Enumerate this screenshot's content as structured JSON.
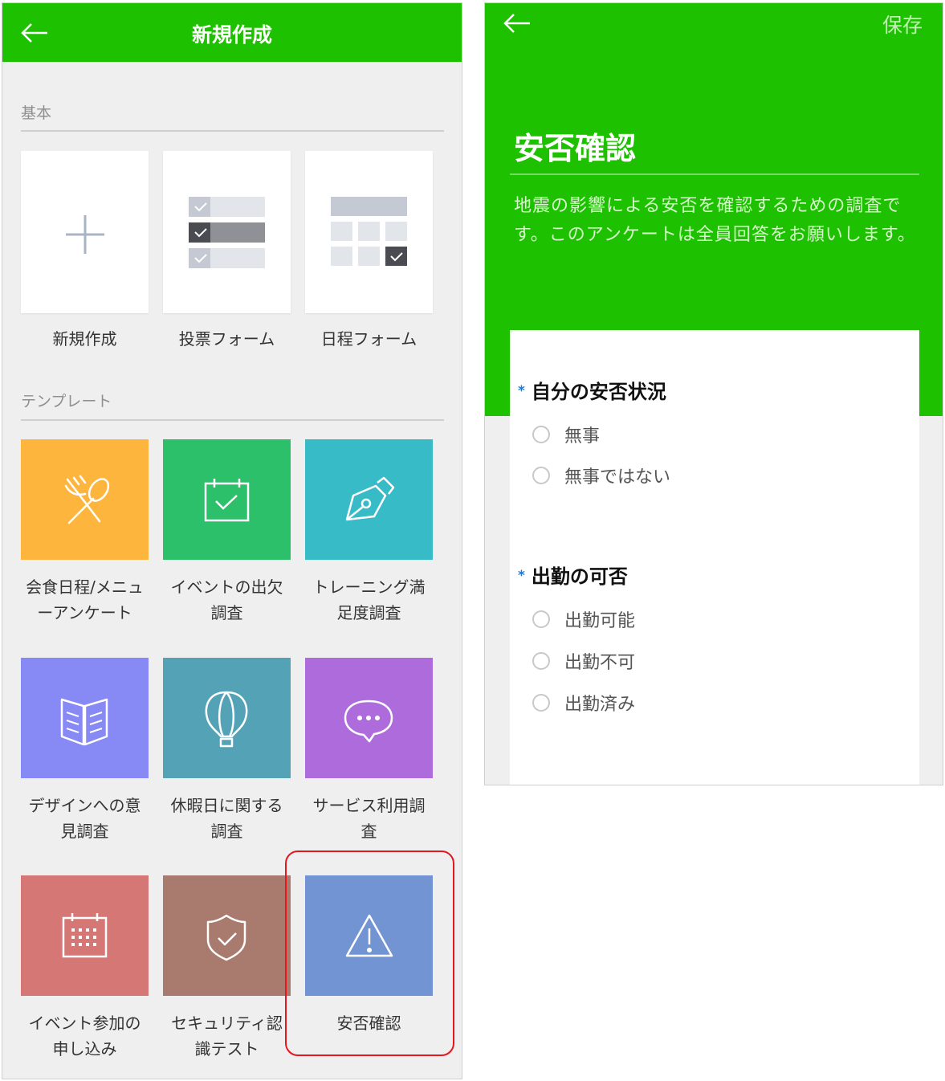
{
  "left": {
    "header_title": "新規作成",
    "basic_label": "基本",
    "basic_cards": [
      {
        "label": "新規作成",
        "icon": "plus-icon"
      },
      {
        "label": "投票フォーム",
        "icon": "checklist-icon"
      },
      {
        "label": "日程フォーム",
        "icon": "schedule-grid-icon"
      }
    ],
    "template_label": "テンプレート",
    "templates": [
      {
        "line1": "会食日程/メニュ",
        "line2": "ーアンケート",
        "icon": "fork-spoon-icon",
        "color": "#fdb53e"
      },
      {
        "line1": "イベントの出欠",
        "line2": "調査",
        "icon": "calendar-check-icon",
        "color": "#2dc06a"
      },
      {
        "line1": "トレーニング満",
        "line2": "足度調査",
        "icon": "pen-nib-icon",
        "color": "#36bbc7"
      },
      {
        "line1": "デザインへの意",
        "line2": "見調査",
        "icon": "open-book-icon",
        "color": "#8789f5"
      },
      {
        "line1": "休暇日に関する",
        "line2": "調査",
        "icon": "hot-air-balloon-icon",
        "color": "#53a2b6"
      },
      {
        "line1": "サービス利用調",
        "line2": "査",
        "icon": "speech-bubble-icon",
        "color": "#ad6bdc"
      },
      {
        "line1": "イベント参加の",
        "line2": "申し込み",
        "icon": "calendar-grid-icon",
        "color": "#d57774"
      },
      {
        "line1": "セキュリティ認",
        "line2": "識テスト",
        "icon": "shield-check-icon",
        "color": "#a87b6e"
      },
      {
        "line1": "安否確認",
        "line2": "",
        "icon": "warning-triangle-icon",
        "color": "#7294d3"
      }
    ]
  },
  "right": {
    "save_label": "保存",
    "form_title": "安否確認",
    "form_description": "地震の影響による安否を確認するための調査です。このアンケートは全員回答をお願いします。",
    "required_mark": "*",
    "questions": [
      {
        "title": "自分の安否状況",
        "options": [
          "無事",
          "無事ではない"
        ]
      },
      {
        "title": "出勤の可否",
        "options": [
          "出勤可能",
          "出勤不可",
          "出勤済み"
        ]
      }
    ]
  }
}
